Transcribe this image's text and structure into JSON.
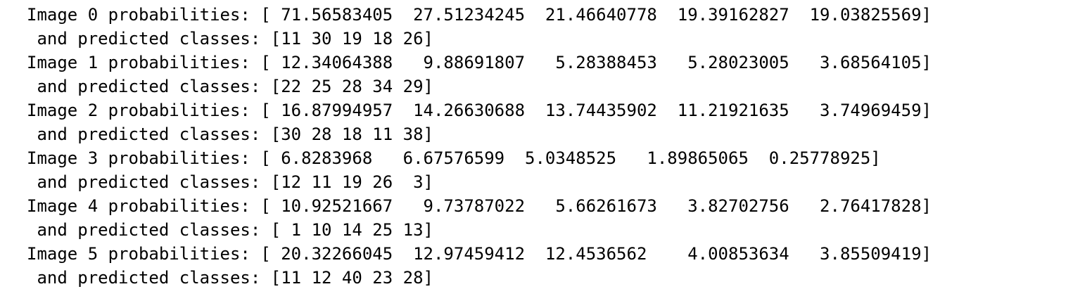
{
  "output": {
    "lines": [
      "Image 0 probabilities: [ 71.56583405  27.51234245  21.46640778  19.39162827  19.03825569]",
      " and predicted classes: [11 30 19 18 26]",
      "Image 1 probabilities: [ 12.34064388   9.88691807   5.28388453   5.28023005   3.68564105]",
      " and predicted classes: [22 25 28 34 29]",
      "Image 2 probabilities: [ 16.87994957  14.26630688  13.74435902  11.21921635   3.74969459]",
      " and predicted classes: [30 28 18 11 38]",
      "Image 3 probabilities: [ 6.8283968   6.67576599  5.0348525   1.89865065  0.25778925]",
      " and predicted classes: [12 11 19 26  3]",
      "Image 4 probabilities: [ 10.92521667   9.73787022   5.66261673   3.82702756   2.76417828]",
      " and predicted classes: [ 1 10 14 25 13]",
      "Image 5 probabilities: [ 20.32266045  12.97459412  12.4536562    4.00853634   3.85509419]",
      " and predicted classes: [11 12 40 23 28]"
    ]
  }
}
